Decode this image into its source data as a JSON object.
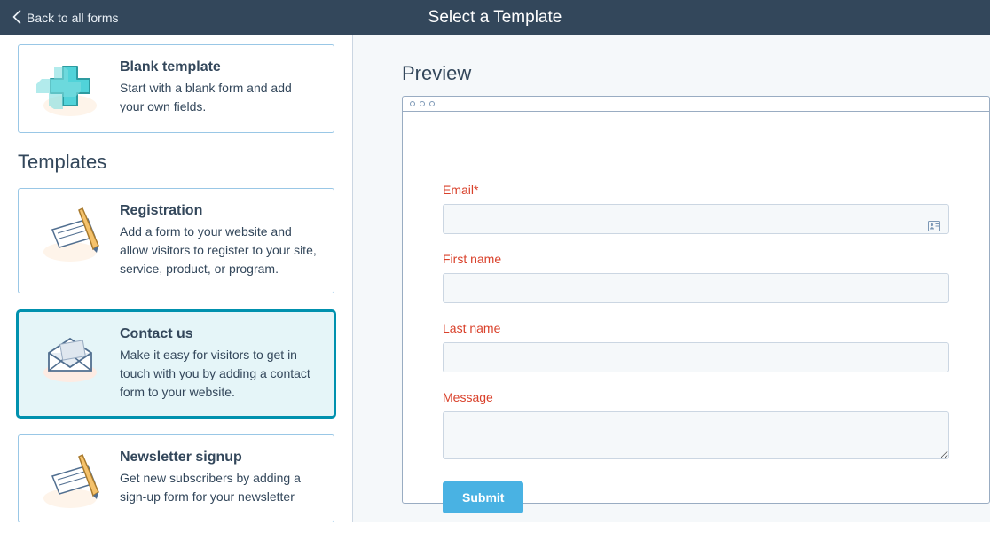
{
  "header": {
    "back_label": "Back to all forms",
    "title": "Select a Template"
  },
  "sidebar": {
    "blank": {
      "title": "Blank template",
      "desc": "Start with a blank form and add your own fields."
    },
    "section_title": "Templates",
    "templates": [
      {
        "title": "Registration",
        "desc": "Add a form to your website and allow visitors to register to your site, service, product, or program."
      },
      {
        "title": "Contact us",
        "desc": "Make it easy for visitors to get in touch with you by adding a contact form to your website."
      },
      {
        "title": "Newsletter signup",
        "desc": "Get new subscribers by adding a sign-up form for your newsletter"
      }
    ]
  },
  "preview": {
    "title": "Preview",
    "fields": {
      "email_label": "Email*",
      "firstname_label": "First name",
      "lastname_label": "Last name",
      "message_label": "Message"
    },
    "submit_label": "Submit"
  }
}
